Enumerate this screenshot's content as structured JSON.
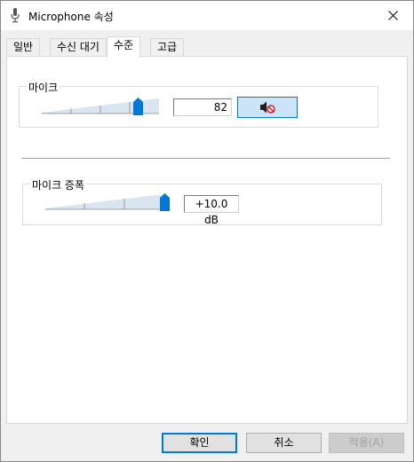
{
  "window": {
    "title": "Microphone 속성",
    "icon": "microphone-icon",
    "close_icon": "close-icon"
  },
  "tabs": [
    {
      "label": "일반",
      "active": false
    },
    {
      "label": "수신 대기",
      "active": false
    },
    {
      "label": "수준",
      "active": true
    },
    {
      "label": "고급",
      "active": false
    }
  ],
  "microphone": {
    "label": "마이크",
    "level": 82,
    "level_text": "82",
    "level_fraction": 0.82,
    "mute_icon": "speaker-muted-icon",
    "muted": true
  },
  "boost": {
    "label": "마이크 증폭",
    "value_text": "+10.0 dB",
    "level_fraction": 1.0
  },
  "buttons": {
    "ok": "확인",
    "cancel": "취소",
    "apply": "적용(A)"
  },
  "colors": {
    "accent": "#0078d7",
    "selected_button_bg": "#cce4f7",
    "mute_red": "#e81123"
  }
}
